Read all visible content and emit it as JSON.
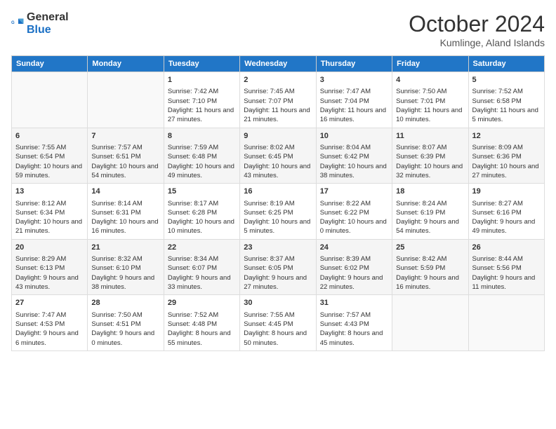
{
  "header": {
    "logo_general": "General",
    "logo_blue": "Blue",
    "month_title": "October 2024",
    "location": "Kumlinge, Aland Islands"
  },
  "days_of_week": [
    "Sunday",
    "Monday",
    "Tuesday",
    "Wednesday",
    "Thursday",
    "Friday",
    "Saturday"
  ],
  "weeks": [
    [
      {
        "day": "",
        "info": ""
      },
      {
        "day": "",
        "info": ""
      },
      {
        "day": "1",
        "info": "Sunrise: 7:42 AM\nSunset: 7:10 PM\nDaylight: 11 hours and 27 minutes."
      },
      {
        "day": "2",
        "info": "Sunrise: 7:45 AM\nSunset: 7:07 PM\nDaylight: 11 hours and 21 minutes."
      },
      {
        "day": "3",
        "info": "Sunrise: 7:47 AM\nSunset: 7:04 PM\nDaylight: 11 hours and 16 minutes."
      },
      {
        "day": "4",
        "info": "Sunrise: 7:50 AM\nSunset: 7:01 PM\nDaylight: 11 hours and 10 minutes."
      },
      {
        "day": "5",
        "info": "Sunrise: 7:52 AM\nSunset: 6:58 PM\nDaylight: 11 hours and 5 minutes."
      }
    ],
    [
      {
        "day": "6",
        "info": "Sunrise: 7:55 AM\nSunset: 6:54 PM\nDaylight: 10 hours and 59 minutes."
      },
      {
        "day": "7",
        "info": "Sunrise: 7:57 AM\nSunset: 6:51 PM\nDaylight: 10 hours and 54 minutes."
      },
      {
        "day": "8",
        "info": "Sunrise: 7:59 AM\nSunset: 6:48 PM\nDaylight: 10 hours and 49 minutes."
      },
      {
        "day": "9",
        "info": "Sunrise: 8:02 AM\nSunset: 6:45 PM\nDaylight: 10 hours and 43 minutes."
      },
      {
        "day": "10",
        "info": "Sunrise: 8:04 AM\nSunset: 6:42 PM\nDaylight: 10 hours and 38 minutes."
      },
      {
        "day": "11",
        "info": "Sunrise: 8:07 AM\nSunset: 6:39 PM\nDaylight: 10 hours and 32 minutes."
      },
      {
        "day": "12",
        "info": "Sunrise: 8:09 AM\nSunset: 6:36 PM\nDaylight: 10 hours and 27 minutes."
      }
    ],
    [
      {
        "day": "13",
        "info": "Sunrise: 8:12 AM\nSunset: 6:34 PM\nDaylight: 10 hours and 21 minutes."
      },
      {
        "day": "14",
        "info": "Sunrise: 8:14 AM\nSunset: 6:31 PM\nDaylight: 10 hours and 16 minutes."
      },
      {
        "day": "15",
        "info": "Sunrise: 8:17 AM\nSunset: 6:28 PM\nDaylight: 10 hours and 10 minutes."
      },
      {
        "day": "16",
        "info": "Sunrise: 8:19 AM\nSunset: 6:25 PM\nDaylight: 10 hours and 5 minutes."
      },
      {
        "day": "17",
        "info": "Sunrise: 8:22 AM\nSunset: 6:22 PM\nDaylight: 10 hours and 0 minutes."
      },
      {
        "day": "18",
        "info": "Sunrise: 8:24 AM\nSunset: 6:19 PM\nDaylight: 9 hours and 54 minutes."
      },
      {
        "day": "19",
        "info": "Sunrise: 8:27 AM\nSunset: 6:16 PM\nDaylight: 9 hours and 49 minutes."
      }
    ],
    [
      {
        "day": "20",
        "info": "Sunrise: 8:29 AM\nSunset: 6:13 PM\nDaylight: 9 hours and 43 minutes."
      },
      {
        "day": "21",
        "info": "Sunrise: 8:32 AM\nSunset: 6:10 PM\nDaylight: 9 hours and 38 minutes."
      },
      {
        "day": "22",
        "info": "Sunrise: 8:34 AM\nSunset: 6:07 PM\nDaylight: 9 hours and 33 minutes."
      },
      {
        "day": "23",
        "info": "Sunrise: 8:37 AM\nSunset: 6:05 PM\nDaylight: 9 hours and 27 minutes."
      },
      {
        "day": "24",
        "info": "Sunrise: 8:39 AM\nSunset: 6:02 PM\nDaylight: 9 hours and 22 minutes."
      },
      {
        "day": "25",
        "info": "Sunrise: 8:42 AM\nSunset: 5:59 PM\nDaylight: 9 hours and 16 minutes."
      },
      {
        "day": "26",
        "info": "Sunrise: 8:44 AM\nSunset: 5:56 PM\nDaylight: 9 hours and 11 minutes."
      }
    ],
    [
      {
        "day": "27",
        "info": "Sunrise: 7:47 AM\nSunset: 4:53 PM\nDaylight: 9 hours and 6 minutes."
      },
      {
        "day": "28",
        "info": "Sunrise: 7:50 AM\nSunset: 4:51 PM\nDaylight: 9 hours and 0 minutes."
      },
      {
        "day": "29",
        "info": "Sunrise: 7:52 AM\nSunset: 4:48 PM\nDaylight: 8 hours and 55 minutes."
      },
      {
        "day": "30",
        "info": "Sunrise: 7:55 AM\nSunset: 4:45 PM\nDaylight: 8 hours and 50 minutes."
      },
      {
        "day": "31",
        "info": "Sunrise: 7:57 AM\nSunset: 4:43 PM\nDaylight: 8 hours and 45 minutes."
      },
      {
        "day": "",
        "info": ""
      },
      {
        "day": "",
        "info": ""
      }
    ]
  ]
}
